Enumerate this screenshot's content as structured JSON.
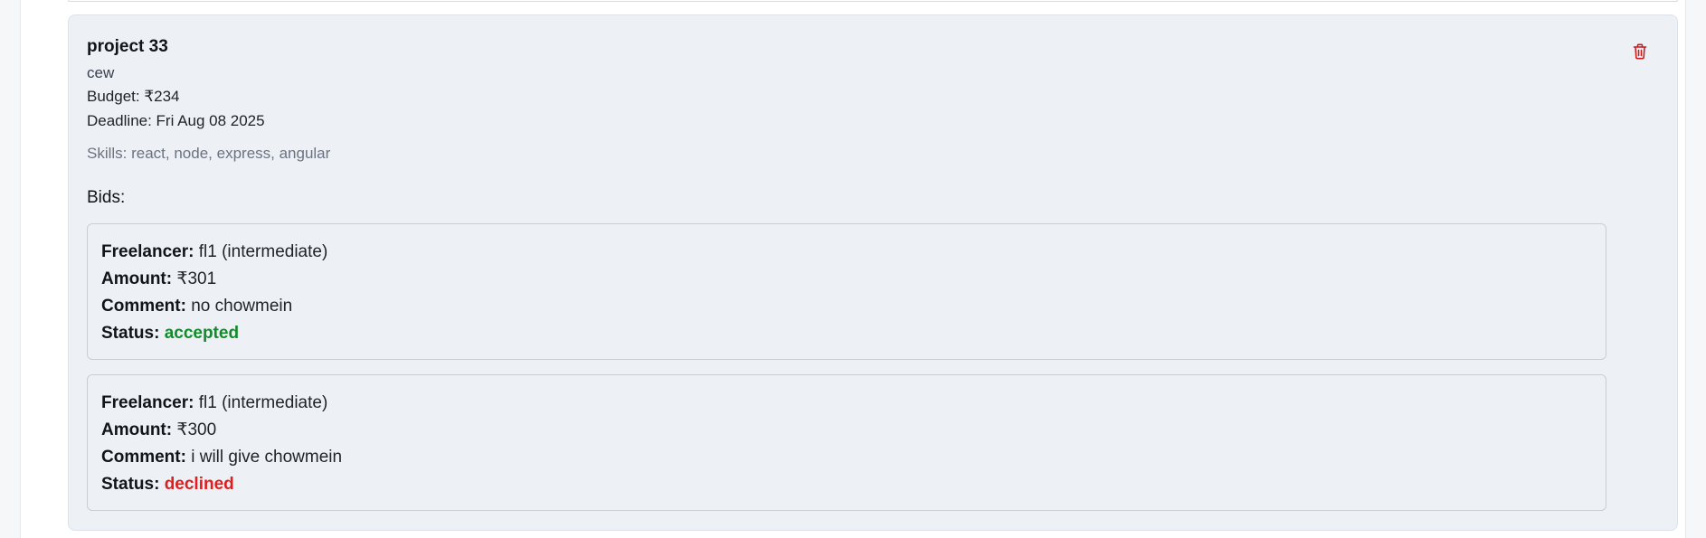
{
  "project": {
    "title": "project 33",
    "description": "cew",
    "budget_text": "Budget: ₹234",
    "deadline_text": "Deadline: Fri Aug 08 2025",
    "skills_text": "Skills: react, node, express, angular",
    "delete_icon": "trash-icon",
    "delete_color": "#c81e1e"
  },
  "bids_heading": "Bids:",
  "bid_labels": {
    "freelancer": "Freelancer:",
    "amount": "Amount:",
    "comment": "Comment:",
    "status": "Status:"
  },
  "bids": [
    {
      "freelancer": "fl1 (intermediate)",
      "amount": "₹301",
      "comment": "no chowmein",
      "status": "accepted",
      "status_color": "#138a2b"
    },
    {
      "freelancer": "fl1 (intermediate)",
      "amount": "₹300",
      "comment": "i will give chowmein",
      "status": "declined",
      "status_color": "#e11d1d"
    }
  ]
}
